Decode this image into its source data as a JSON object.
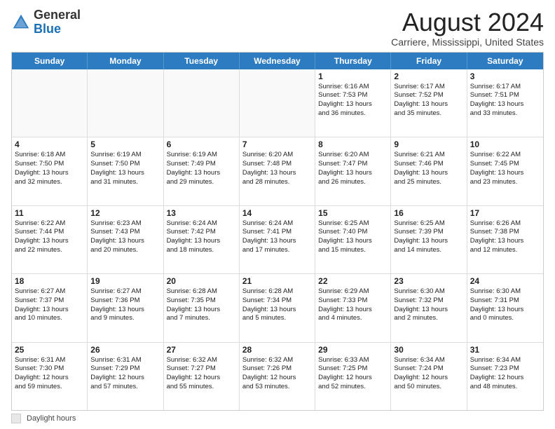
{
  "logo": {
    "general": "General",
    "blue": "Blue"
  },
  "title": "August 2024",
  "location": "Carriere, Mississippi, United States",
  "days_of_week": [
    "Sunday",
    "Monday",
    "Tuesday",
    "Wednesday",
    "Thursday",
    "Friday",
    "Saturday"
  ],
  "weeks": [
    [
      {
        "day": "",
        "empty": true,
        "lines": []
      },
      {
        "day": "",
        "empty": true,
        "lines": []
      },
      {
        "day": "",
        "empty": true,
        "lines": []
      },
      {
        "day": "",
        "empty": true,
        "lines": []
      },
      {
        "day": "1",
        "empty": false,
        "lines": [
          "Sunrise: 6:16 AM",
          "Sunset: 7:53 PM",
          "Daylight: 13 hours",
          "and 36 minutes."
        ]
      },
      {
        "day": "2",
        "empty": false,
        "lines": [
          "Sunrise: 6:17 AM",
          "Sunset: 7:52 PM",
          "Daylight: 13 hours",
          "and 35 minutes."
        ]
      },
      {
        "day": "3",
        "empty": false,
        "lines": [
          "Sunrise: 6:17 AM",
          "Sunset: 7:51 PM",
          "Daylight: 13 hours",
          "and 33 minutes."
        ]
      }
    ],
    [
      {
        "day": "4",
        "empty": false,
        "lines": [
          "Sunrise: 6:18 AM",
          "Sunset: 7:50 PM",
          "Daylight: 13 hours",
          "and 32 minutes."
        ]
      },
      {
        "day": "5",
        "empty": false,
        "lines": [
          "Sunrise: 6:19 AM",
          "Sunset: 7:50 PM",
          "Daylight: 13 hours",
          "and 31 minutes."
        ]
      },
      {
        "day": "6",
        "empty": false,
        "lines": [
          "Sunrise: 6:19 AM",
          "Sunset: 7:49 PM",
          "Daylight: 13 hours",
          "and 29 minutes."
        ]
      },
      {
        "day": "7",
        "empty": false,
        "lines": [
          "Sunrise: 6:20 AM",
          "Sunset: 7:48 PM",
          "Daylight: 13 hours",
          "and 28 minutes."
        ]
      },
      {
        "day": "8",
        "empty": false,
        "lines": [
          "Sunrise: 6:20 AM",
          "Sunset: 7:47 PM",
          "Daylight: 13 hours",
          "and 26 minutes."
        ]
      },
      {
        "day": "9",
        "empty": false,
        "lines": [
          "Sunrise: 6:21 AM",
          "Sunset: 7:46 PM",
          "Daylight: 13 hours",
          "and 25 minutes."
        ]
      },
      {
        "day": "10",
        "empty": false,
        "lines": [
          "Sunrise: 6:22 AM",
          "Sunset: 7:45 PM",
          "Daylight: 13 hours",
          "and 23 minutes."
        ]
      }
    ],
    [
      {
        "day": "11",
        "empty": false,
        "lines": [
          "Sunrise: 6:22 AM",
          "Sunset: 7:44 PM",
          "Daylight: 13 hours",
          "and 22 minutes."
        ]
      },
      {
        "day": "12",
        "empty": false,
        "lines": [
          "Sunrise: 6:23 AM",
          "Sunset: 7:43 PM",
          "Daylight: 13 hours",
          "and 20 minutes."
        ]
      },
      {
        "day": "13",
        "empty": false,
        "lines": [
          "Sunrise: 6:24 AM",
          "Sunset: 7:42 PM",
          "Daylight: 13 hours",
          "and 18 minutes."
        ]
      },
      {
        "day": "14",
        "empty": false,
        "lines": [
          "Sunrise: 6:24 AM",
          "Sunset: 7:41 PM",
          "Daylight: 13 hours",
          "and 17 minutes."
        ]
      },
      {
        "day": "15",
        "empty": false,
        "lines": [
          "Sunrise: 6:25 AM",
          "Sunset: 7:40 PM",
          "Daylight: 13 hours",
          "and 15 minutes."
        ]
      },
      {
        "day": "16",
        "empty": false,
        "lines": [
          "Sunrise: 6:25 AM",
          "Sunset: 7:39 PM",
          "Daylight: 13 hours",
          "and 14 minutes."
        ]
      },
      {
        "day": "17",
        "empty": false,
        "lines": [
          "Sunrise: 6:26 AM",
          "Sunset: 7:38 PM",
          "Daylight: 13 hours",
          "and 12 minutes."
        ]
      }
    ],
    [
      {
        "day": "18",
        "empty": false,
        "lines": [
          "Sunrise: 6:27 AM",
          "Sunset: 7:37 PM",
          "Daylight: 13 hours",
          "and 10 minutes."
        ]
      },
      {
        "day": "19",
        "empty": false,
        "lines": [
          "Sunrise: 6:27 AM",
          "Sunset: 7:36 PM",
          "Daylight: 13 hours",
          "and 9 minutes."
        ]
      },
      {
        "day": "20",
        "empty": false,
        "lines": [
          "Sunrise: 6:28 AM",
          "Sunset: 7:35 PM",
          "Daylight: 13 hours",
          "and 7 minutes."
        ]
      },
      {
        "day": "21",
        "empty": false,
        "lines": [
          "Sunrise: 6:28 AM",
          "Sunset: 7:34 PM",
          "Daylight: 13 hours",
          "and 5 minutes."
        ]
      },
      {
        "day": "22",
        "empty": false,
        "lines": [
          "Sunrise: 6:29 AM",
          "Sunset: 7:33 PM",
          "Daylight: 13 hours",
          "and 4 minutes."
        ]
      },
      {
        "day": "23",
        "empty": false,
        "lines": [
          "Sunrise: 6:30 AM",
          "Sunset: 7:32 PM",
          "Daylight: 13 hours",
          "and 2 minutes."
        ]
      },
      {
        "day": "24",
        "empty": false,
        "lines": [
          "Sunrise: 6:30 AM",
          "Sunset: 7:31 PM",
          "Daylight: 13 hours",
          "and 0 minutes."
        ]
      }
    ],
    [
      {
        "day": "25",
        "empty": false,
        "lines": [
          "Sunrise: 6:31 AM",
          "Sunset: 7:30 PM",
          "Daylight: 12 hours",
          "and 59 minutes."
        ]
      },
      {
        "day": "26",
        "empty": false,
        "lines": [
          "Sunrise: 6:31 AM",
          "Sunset: 7:29 PM",
          "Daylight: 12 hours",
          "and 57 minutes."
        ]
      },
      {
        "day": "27",
        "empty": false,
        "lines": [
          "Sunrise: 6:32 AM",
          "Sunset: 7:27 PM",
          "Daylight: 12 hours",
          "and 55 minutes."
        ]
      },
      {
        "day": "28",
        "empty": false,
        "lines": [
          "Sunrise: 6:32 AM",
          "Sunset: 7:26 PM",
          "Daylight: 12 hours",
          "and 53 minutes."
        ]
      },
      {
        "day": "29",
        "empty": false,
        "lines": [
          "Sunrise: 6:33 AM",
          "Sunset: 7:25 PM",
          "Daylight: 12 hours",
          "and 52 minutes."
        ]
      },
      {
        "day": "30",
        "empty": false,
        "lines": [
          "Sunrise: 6:34 AM",
          "Sunset: 7:24 PM",
          "Daylight: 12 hours",
          "and 50 minutes."
        ]
      },
      {
        "day": "31",
        "empty": false,
        "lines": [
          "Sunrise: 6:34 AM",
          "Sunset: 7:23 PM",
          "Daylight: 12 hours",
          "and 48 minutes."
        ]
      }
    ]
  ],
  "legend": {
    "box_label": "Daylight hours"
  }
}
